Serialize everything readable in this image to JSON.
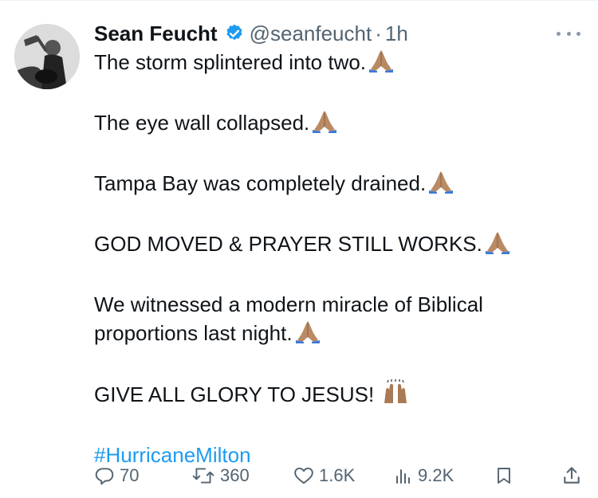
{
  "author": {
    "name": "Sean Feucht",
    "handle": "@seanfeucht",
    "time": "1h"
  },
  "tweet": {
    "p1": "The storm splintered into two.",
    "p2": "The eye wall collapsed.",
    "p3": "Tampa Bay was completely drained.",
    "p4": "GOD MOVED & PRAYER STILL WORKS.",
    "p5": "We witnessed a modern miracle of Biblical proportions last night.",
    "p6": "GIVE ALL GLORY TO JESUS!",
    "hashtag": "#HurricaneMilton",
    "emoji_pray": "folded-hands",
    "emoji_praise": "raising-hands"
  },
  "actions": {
    "replies": "70",
    "reposts": "360",
    "likes": "1.6K",
    "views": "9.2K"
  },
  "icons": {
    "verified": "verified-badge-icon",
    "reply": "reply-icon",
    "repost": "repost-icon",
    "like": "heart-icon",
    "views": "views-icon",
    "bookmark": "bookmark-icon",
    "share": "share-icon"
  },
  "colors": {
    "text": "#0f1419",
    "muted": "#536471",
    "accent": "#1d9bf0"
  }
}
